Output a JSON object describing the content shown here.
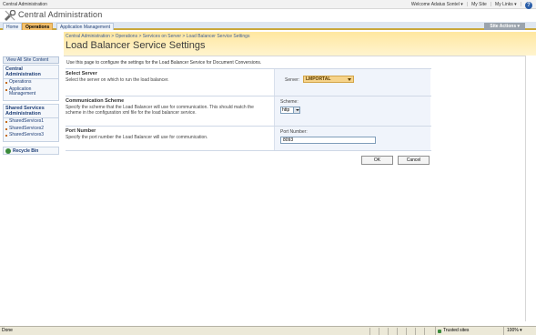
{
  "topbar": {
    "site_name": "Central Administration",
    "welcome": "Welcome Adatus Sontel ▾",
    "my_site": "My Site",
    "my_links": "My Links ▾"
  },
  "header": {
    "title": "Central Administration"
  },
  "tabs": [
    {
      "label": "Home"
    },
    {
      "label": "Operations"
    },
    {
      "label": "Application Management"
    }
  ],
  "site_actions": "Site Actions ▾",
  "leftnav": {
    "view_all": "View All Site Content",
    "section1": {
      "title": "Central Administration",
      "items": [
        "Operations",
        "Application Management"
      ]
    },
    "section2": {
      "title": "Shared Services Administration",
      "items": [
        "SharedServices1",
        "SharedServices2",
        "SharedServices3"
      ]
    },
    "recycle": "Recycle Bin"
  },
  "breadcrumb": "Central Administration > Operations > Services on Server > Load Balancer Service Settings",
  "page_title": "Load Balancer Service Settings",
  "intro": "Use this page to configure the settings for the Load Balancer Service for Document Conversions.",
  "sections": {
    "server": {
      "title": "Select Server",
      "desc": "Select the server on which to run the load balancer.",
      "label": "Server:",
      "value": "LMPORTAL"
    },
    "scheme": {
      "title": "Communication Scheme",
      "desc": "Specify the scheme that the Load Balancer will use for communication. This should match the scheme in the configuration xml file for the load balancer service.",
      "label": "Scheme:",
      "value": "http"
    },
    "port": {
      "title": "Port Number",
      "desc": "Specify the port number the Load Balancer will use for communication.",
      "label": "Port Number:",
      "value": "8093"
    }
  },
  "buttons": {
    "ok": "OK",
    "cancel": "Cancel"
  },
  "statusbar": {
    "status": "Done",
    "zone": "Trusted sites",
    "zoom": "100% ▾"
  },
  "colors": {
    "title_bar": "#ffe7a0",
    "tab_active": "#f5c16c",
    "link": "#1f3f77"
  }
}
